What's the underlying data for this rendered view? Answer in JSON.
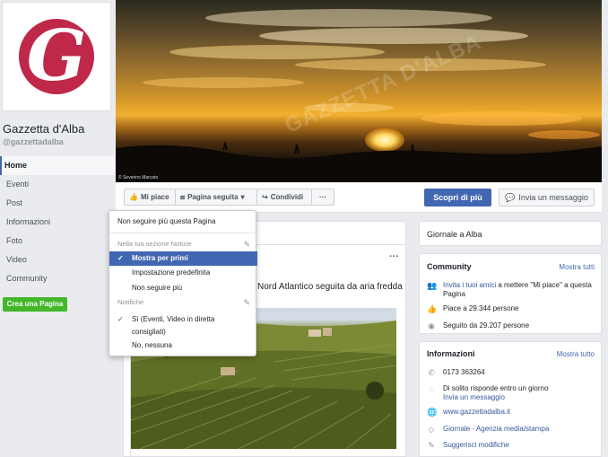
{
  "page": {
    "logo_letter": "G",
    "name": "Gazzetta d'Alba",
    "handle": "@gazzettadalba"
  },
  "sidebar": {
    "items": [
      {
        "label": "Home",
        "active": true
      },
      {
        "label": "Eventi"
      },
      {
        "label": "Post"
      },
      {
        "label": "Informazioni"
      },
      {
        "label": "Foto"
      },
      {
        "label": "Video"
      },
      {
        "label": "Community"
      }
    ],
    "create_page": "Crea una Pagina"
  },
  "cover": {
    "watermark": "GAZZETTA D'ALBA",
    "credit": "© Severino Marcato"
  },
  "actions": {
    "like": "Mi piace",
    "follow": "Pagina seguita",
    "share": "Condividi",
    "more": "···",
    "learn_more": "Scopri di più",
    "message": "Invia un messaggio"
  },
  "follow_menu": {
    "unfollow": "Non seguire più questa Pagina",
    "news_header": "Nella tua sezione Notizie",
    "see_first": "Mostra per primi",
    "default": "Impostazione predefinita",
    "unfollow_short": "Non seguire più",
    "notif_header": "Notifiche",
    "notif_on": "Sì (Eventi, Video in diretta consigliati)",
    "notif_off": "No, nessuna"
  },
  "post": {
    "text": "Nord Atlantico seguita da aria fredda",
    "menu": "···"
  },
  "right": {
    "location": "Giornale a Alba",
    "community": {
      "title": "Community",
      "see_all": "Mostra tutti",
      "invite_link": "Invita i tuoi amici",
      "invite_rest": " a mettere \"Mi piace\" a questa Pagina",
      "likes": "Piace a 29.344 persone",
      "follows": "Seguito da 29.207 persone"
    },
    "info": {
      "title": "Informazioni",
      "see_all": "Mostra tutto",
      "phone": "0173 363264",
      "response": "Di solito risponde entro un giorno",
      "send_msg": "Invia un messaggio",
      "website": "www.gazzettadalba.it",
      "category": "Giornale · Agenzia media/stampa",
      "suggest": "Suggerisci modifiche"
    }
  },
  "colors": {
    "fb_blue": "#4267b2",
    "logo_red": "#c0284a",
    "create_green": "#42b72a"
  }
}
